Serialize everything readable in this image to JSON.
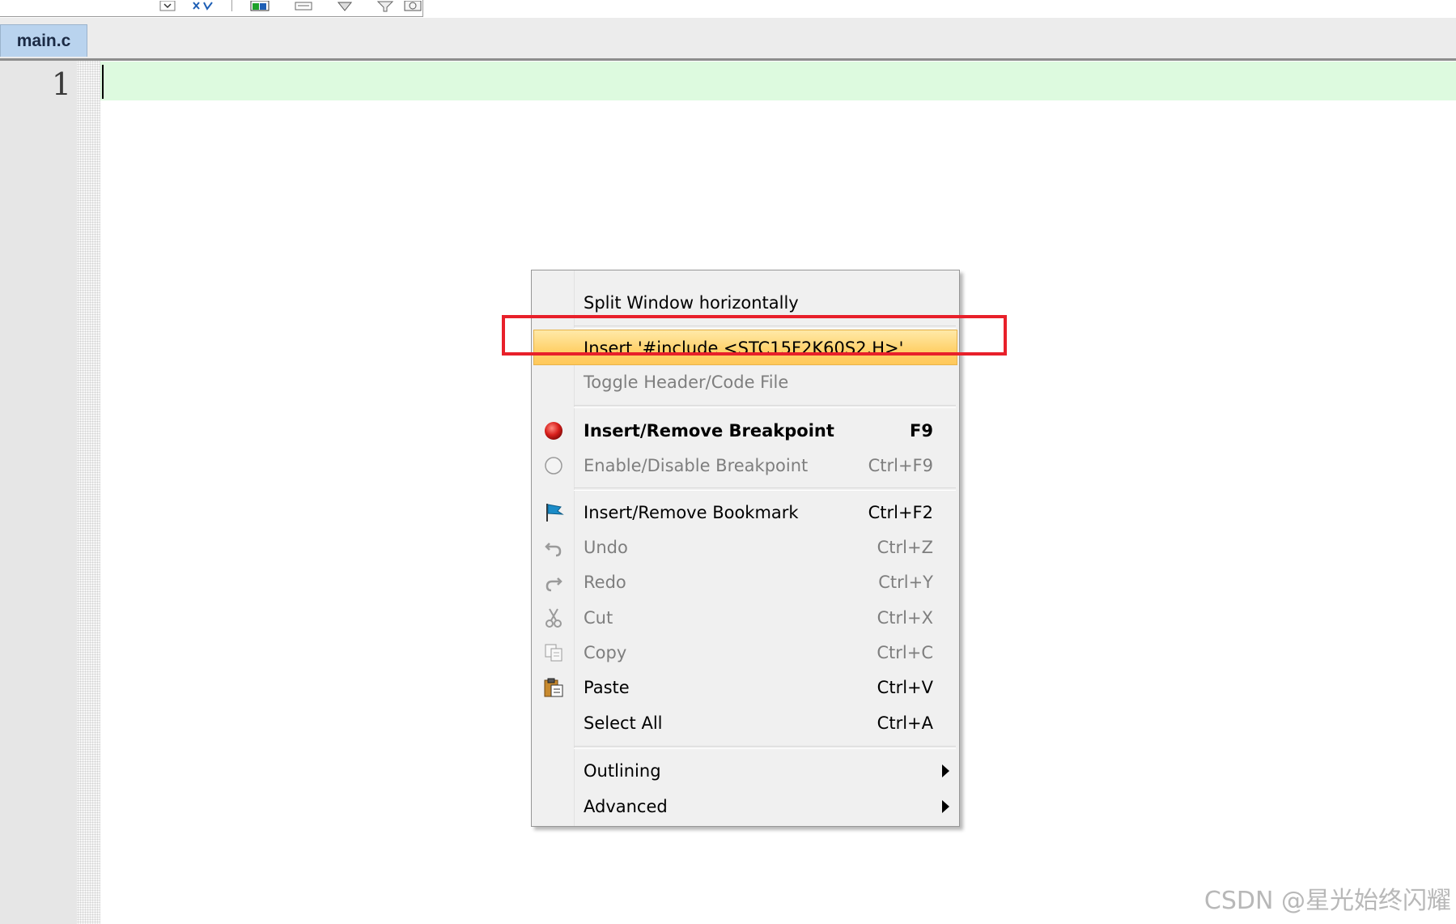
{
  "tab": {
    "label": "main.c"
  },
  "editor": {
    "line_numbers": [
      "1"
    ]
  },
  "toolbar": {
    "icons": [
      "dropdown-icon",
      "find-icon",
      "window-icon",
      "print-icon",
      "gem-icon",
      "filter-icon",
      "config-icon"
    ]
  },
  "context_menu": {
    "items": [
      {
        "label": "Split Window horizontally",
        "shortcut": ""
      },
      {
        "label": "Insert '#include <STC15F2K60S2.H>'",
        "shortcut": ""
      },
      {
        "label": "Toggle Header/Code File",
        "shortcut": ""
      },
      {
        "label": "Insert/Remove Breakpoint",
        "shortcut": "F9"
      },
      {
        "label": "Enable/Disable Breakpoint",
        "shortcut": "Ctrl+F9"
      },
      {
        "label": "Insert/Remove Bookmark",
        "shortcut": "Ctrl+F2"
      },
      {
        "label": "Undo",
        "shortcut": "Ctrl+Z"
      },
      {
        "label": "Redo",
        "shortcut": "Ctrl+Y"
      },
      {
        "label": "Cut",
        "shortcut": "Ctrl+X"
      },
      {
        "label": "Copy",
        "shortcut": "Ctrl+C"
      },
      {
        "label": "Paste",
        "shortcut": "Ctrl+V"
      },
      {
        "label": "Select All",
        "shortcut": "Ctrl+A"
      },
      {
        "label": "Outlining",
        "shortcut": ""
      },
      {
        "label": "Advanced",
        "shortcut": ""
      }
    ]
  },
  "colors": {
    "highlight": "#ffd36e",
    "annotation_border": "#e8202a",
    "current_line": "#ddfadf",
    "tab_active": "#b9d3ee"
  },
  "watermark": "CSDN @星光始终闪耀"
}
